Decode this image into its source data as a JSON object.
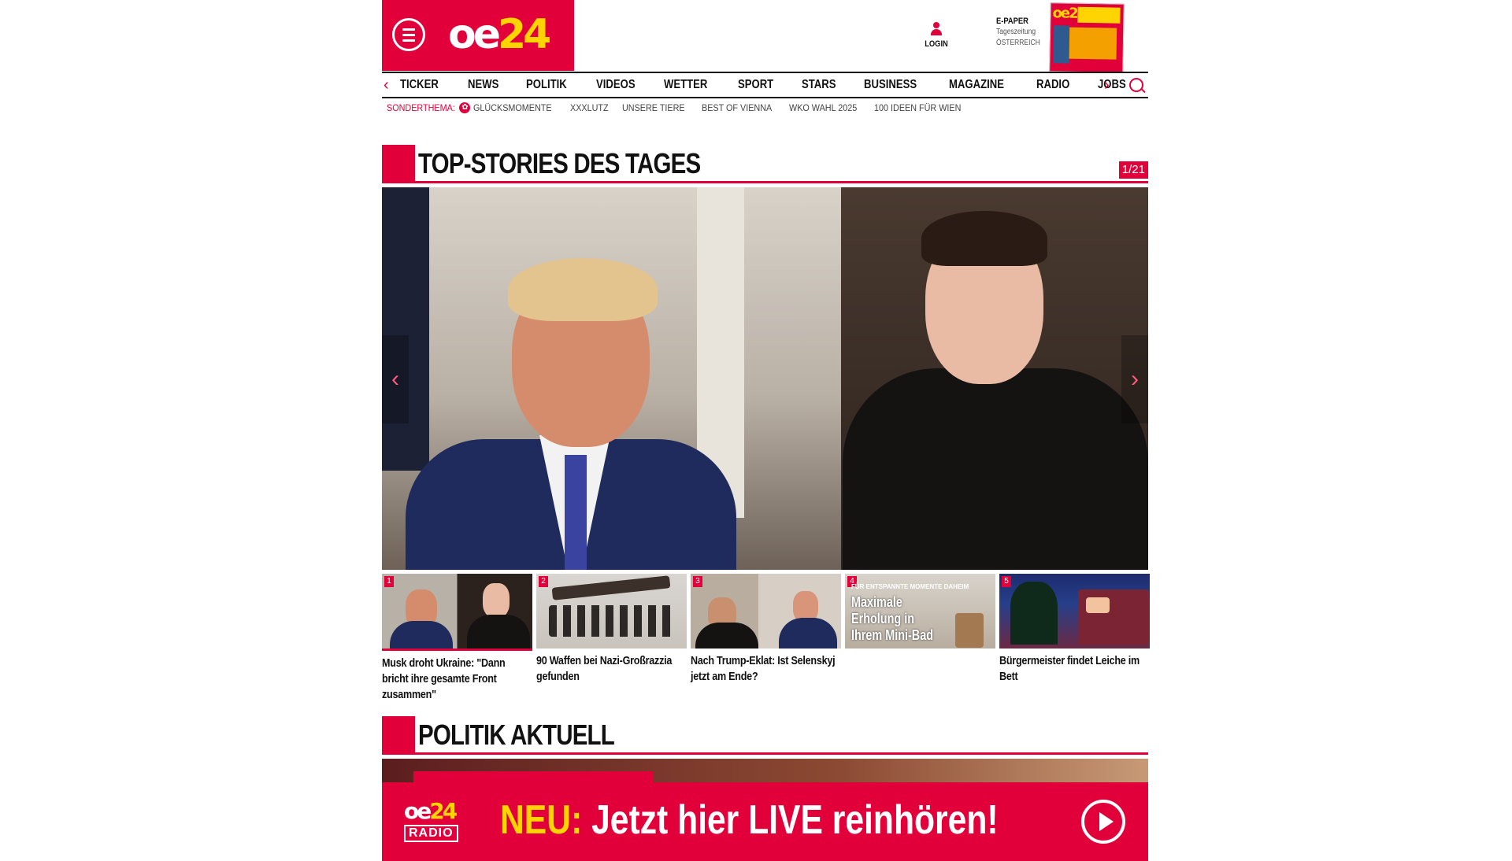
{
  "colors": {
    "brand_red": "#e2003b",
    "brand_yellow": "#ffd400"
  },
  "header": {
    "logo_oe": "oe",
    "logo_24": "24",
    "login_label": "LOGIN",
    "epaper_title": "E-PAPER",
    "epaper_sub1": "Tageszeitung",
    "epaper_sub2": "ÖSTERREICH",
    "epaper_cover_logo": "oe24"
  },
  "nav": {
    "prev_arrow": "‹",
    "next_arrow": "›",
    "items": [
      "TICKER",
      "NEWS",
      "POLITIK",
      "VIDEOS",
      "WETTER",
      "SPORT",
      "STARS",
      "BUSINESS",
      "MAGAZINE",
      "RADIO",
      "JOBS"
    ]
  },
  "subnav": {
    "label": "SONDERTHEMA:",
    "items": [
      "GLÜCKSMOMENTE",
      "XXXLUTZ",
      "UNSERE TIERE",
      "BEST OF VIENNA",
      "WKO WAHL 2025",
      "100 IDEEN FÜR WIEN"
    ]
  },
  "top_stories": {
    "title": "TOP-STORIES DES TAGES",
    "counter": "1/21",
    "prev_arrow": "‹",
    "next_arrow": "›",
    "thumbs": [
      {
        "num": "1",
        "text": "Musk droht Ukraine: \"Dann bricht ihre gesamte Front zusammen\""
      },
      {
        "num": "2",
        "text": "90 Waffen bei Nazi-Großrazzia gefunden"
      },
      {
        "num": "3",
        "text": "Nach Trump-Eklat: Ist Selenskyj jetzt am Ende?"
      },
      {
        "num": "4",
        "text": "",
        "kicker": "FÜR ENTSPANNTE MOMENTE DAHEIM",
        "overlay": "Maximale Erholung in Ihrem Mini-Bad"
      },
      {
        "num": "5",
        "text": "Bürgermeister findet Leiche im Bett"
      }
    ]
  },
  "politik": {
    "title": "POLITIK AKTUELL"
  },
  "radio_banner": {
    "logo_oe": "oe",
    "logo_24": "24",
    "logo_radio": "RADIO",
    "neu": "NEU:",
    "text": " Jetzt hier LIVE reinhören!"
  }
}
